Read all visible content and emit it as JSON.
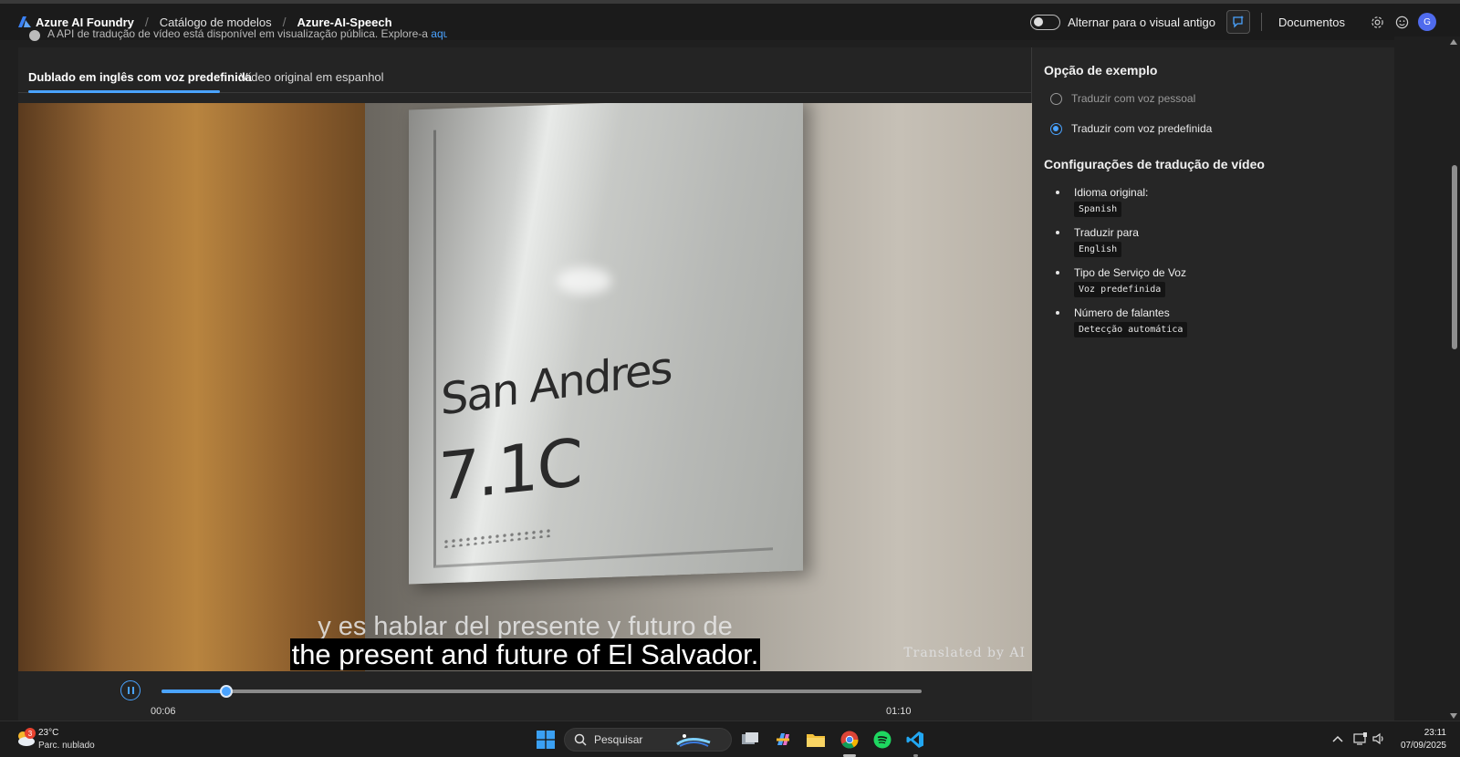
{
  "header": {
    "brand": "Azure AI Foundry",
    "breadcrumbs": [
      "Catálogo de modelos",
      "Azure-AI-Speech"
    ],
    "toggle_label": "Alternar para o visual antigo",
    "docs_label": "Documentos",
    "avatar_initial": "G"
  },
  "notice": {
    "text": "A API de tradução de vídeo está disponível em visualização pública. Explore-a ",
    "link": "aqui."
  },
  "tabs": [
    {
      "label": "Dublado em inglês com voz predefinida",
      "active": true
    },
    {
      "label": "Vídeo original em espanhol",
      "active": false
    }
  ],
  "video": {
    "sign_line1": "San Andres",
    "sign_line2": "7.1C",
    "subtitle_original": "y es hablar del presente y futuro de",
    "subtitle_translated": "the present and future of El Salvador.",
    "watermark": "Translated by AI",
    "time_current": "00:06",
    "time_total": "01:10",
    "progress_fraction": 0.0857
  },
  "options": {
    "heading": "Opção de exemplo",
    "items": [
      {
        "label": "Traduzir com voz pessoal",
        "checked": false
      },
      {
        "label": "Traduzir com voz predefinida",
        "checked": true
      }
    ]
  },
  "settings": {
    "heading": "Configurações de tradução de vídeo",
    "items": [
      {
        "label": "Idioma original:",
        "value": "Spanish"
      },
      {
        "label": "Traduzir para",
        "value": "English"
      },
      {
        "label": "Tipo de Serviço de Voz",
        "value": "Voz predefinida"
      },
      {
        "label": "Número de falantes",
        "value": "Detecção automática"
      }
    ]
  },
  "taskbar": {
    "weather_badge": "3",
    "temperature": "23°C",
    "weather_desc": "Parc. nublado",
    "search_placeholder": "Pesquisar",
    "time": "23:11",
    "date": "07/09/2025"
  },
  "colors": {
    "accent": "#4aa3ff",
    "background": "#1f1f1f"
  }
}
